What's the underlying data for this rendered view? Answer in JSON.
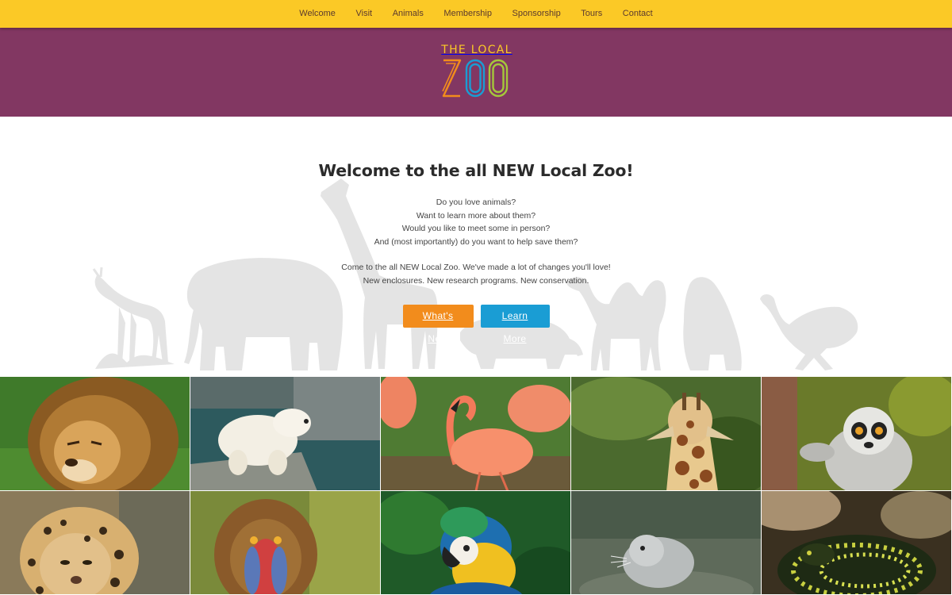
{
  "nav": {
    "items": [
      {
        "label": "Welcome"
      },
      {
        "label": "Visit"
      },
      {
        "label": "Animals"
      },
      {
        "label": "Membership"
      },
      {
        "label": "Sponsorship"
      },
      {
        "label": "Tours"
      },
      {
        "label": "Contact"
      }
    ]
  },
  "logo": {
    "line1": "THE LOCAL",
    "line2": "ZOO",
    "colors": {
      "z": "#f28c1c",
      "o1": "#1a9dd4",
      "o2": "#a5c83a",
      "line1": "#fbc926"
    }
  },
  "hero": {
    "title": "Welcome to the all NEW Local Zoo!",
    "questions": [
      "Do you love animals?",
      "Want to learn more about them?",
      "Would you like to meet some in person?",
      "And (most importantly) do you want to help save them?"
    ],
    "intro": [
      "Come to the all NEW Local Zoo. We've made a lot of changes you'll love!",
      "New enclosures. New research programs. New conservation."
    ],
    "buttons": {
      "whats_new": "What's New",
      "learn_more": "Learn More"
    }
  },
  "colors": {
    "nav_bg": "#fbc926",
    "banner_bg": "#823762",
    "button_orange": "#f28c1c",
    "button_blue": "#1a9dd4",
    "silhouette": "#e4e4e4"
  },
  "gallery": {
    "tiles": [
      {
        "subject": "lion"
      },
      {
        "subject": "polar-bear"
      },
      {
        "subject": "flamingo"
      },
      {
        "subject": "giraffe"
      },
      {
        "subject": "lemur"
      },
      {
        "subject": "leopard"
      },
      {
        "subject": "mandrill"
      },
      {
        "subject": "macaw"
      },
      {
        "subject": "seal"
      },
      {
        "subject": "snake"
      }
    ]
  }
}
